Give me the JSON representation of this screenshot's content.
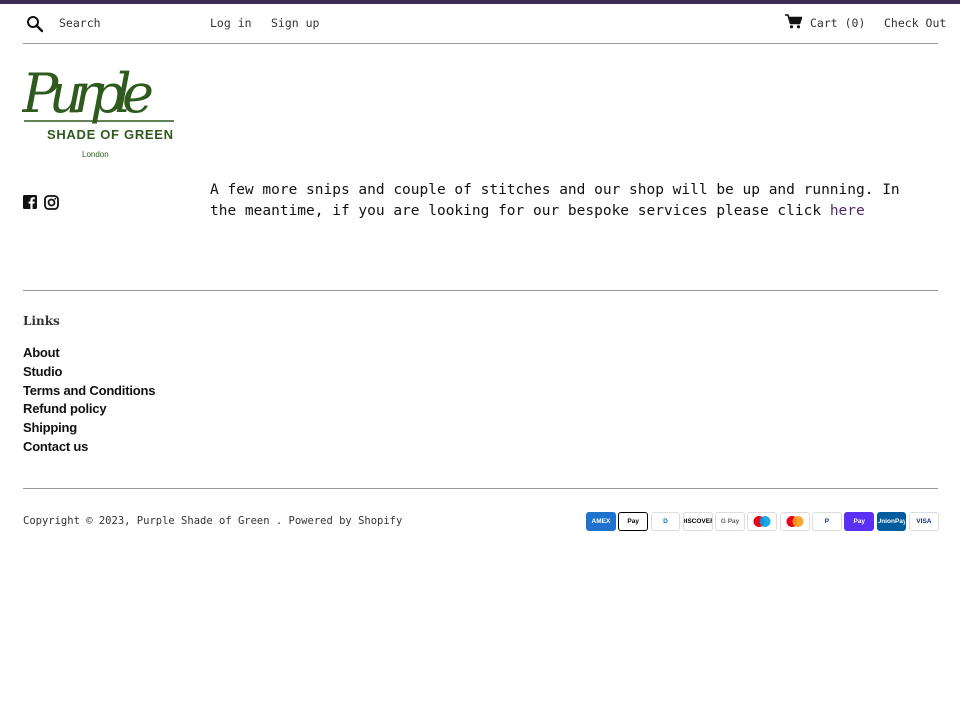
{
  "colors": {
    "accent_bar": "#3c2a54",
    "link": "#4f2a70",
    "logo_green": "#2f5a1e",
    "divider": "#9a9a9a"
  },
  "header": {
    "search_placeholder": "Search",
    "login_label": "Log in",
    "signup_label": "Sign up",
    "cart_label": "Cart (0)",
    "checkout_label": "Check Out",
    "icons": {
      "search": "search-icon",
      "cart": "cart-icon"
    }
  },
  "logo": {
    "script_text": "Purple",
    "main_text": "SHADE OF GREEN",
    "sub_text": "London"
  },
  "social": [
    {
      "icon": "facebook-icon"
    },
    {
      "icon": "instagram-icon"
    }
  ],
  "main": {
    "message": "A few more snips and couple of stitches and our shop will be up and running. In the meantime, if you are looking for our bespoke services please click",
    "link_text": "here"
  },
  "footer": {
    "links_title": "Links",
    "links": [
      "About",
      "Studio",
      "Terms and Conditions",
      "Refund policy",
      "Shipping",
      "Contact us"
    ],
    "copyright_prefix": "Copyright © 2023,",
    "store_name": "Purple Shade of Green",
    "powered_by": ". Powered by Shopify",
    "payments": [
      {
        "name": "American Express",
        "label": "AMEX",
        "bg": "#1f72cd",
        "fg": "#ffffff",
        "border": "#1f72cd"
      },
      {
        "name": "Apple Pay",
        "label": "Pay",
        "bg": "#ffffff",
        "fg": "#000000",
        "border": "#000000"
      },
      {
        "name": "Diners Club",
        "label": "D",
        "bg": "#ffffff",
        "fg": "#0079be",
        "border": "#dddddd"
      },
      {
        "name": "Discover",
        "label": "DISCOVER",
        "bg": "#ffffff",
        "fg": "#000000",
        "border": "#dddddd"
      },
      {
        "name": "Google Pay",
        "label": "G Pay",
        "bg": "#ffffff",
        "fg": "#5f6368",
        "border": "#dddddd"
      },
      {
        "name": "Maestro",
        "label": "",
        "bg": "#ffffff",
        "fg": "#000000",
        "border": "#dddddd"
      },
      {
        "name": "Mastercard",
        "label": "",
        "bg": "#ffffff",
        "fg": "#000000",
        "border": "#dddddd"
      },
      {
        "name": "PayPal",
        "label": "P",
        "bg": "#ffffff",
        "fg": "#003087",
        "border": "#dddddd"
      },
      {
        "name": "Shop Pay",
        "label": "Pay",
        "bg": "#5a31f4",
        "fg": "#ffffff",
        "border": "#5a31f4"
      },
      {
        "name": "Union Pay",
        "label": "UnionPay",
        "bg": "#005b9f",
        "fg": "#ffffff",
        "border": "#005b9f"
      },
      {
        "name": "Visa",
        "label": "VISA",
        "bg": "#ffffff",
        "fg": "#142688",
        "border": "#dddddd"
      }
    ]
  }
}
